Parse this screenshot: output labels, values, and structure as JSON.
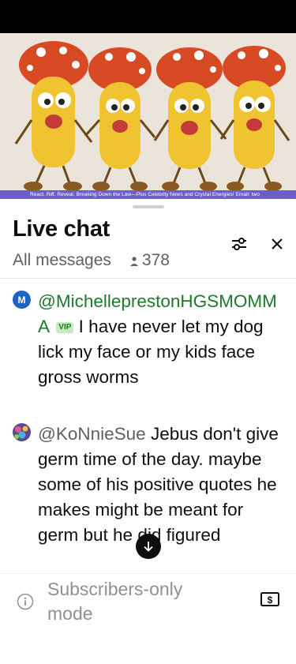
{
  "video": {
    "ticker_text": "React. Riff. Reveal. Breaking Down the Law—Plus Celebrity News and Crystal Energies! Email: two"
  },
  "chat": {
    "title": "Live chat",
    "filter_label": "All messages",
    "viewer_count": "378",
    "messages": [
      {
        "avatar_letter": "M",
        "avatar_color": "#1a64c6",
        "author": "@MichelleprestonHGSMOMMA",
        "badge": "VIP",
        "text": "I have never let my dog lick my face or my kids face gross worms"
      },
      {
        "author": "@KoNnieSue",
        "text": "Jebus don't give germ time of the day. maybe some of his positive quotes he makes might be meant for germ but he did figured"
      }
    ]
  },
  "footer": {
    "subscribers_text": "Subscribers-only mode"
  },
  "colors": {
    "author_green": "#1e7a2a",
    "ticker_purple": "#6b5fc7"
  }
}
